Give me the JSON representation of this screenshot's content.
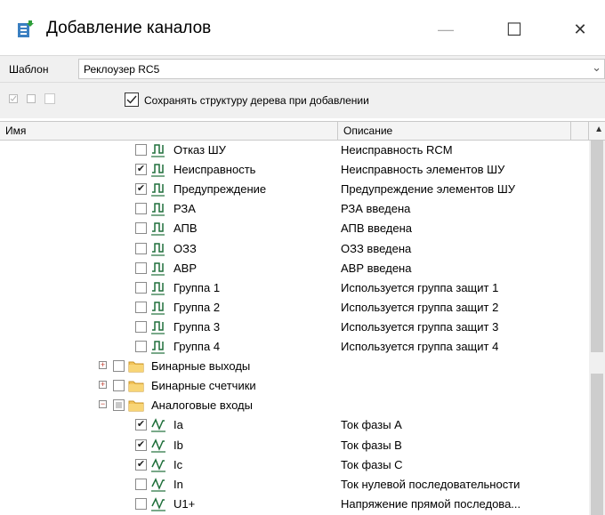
{
  "window": {
    "title": "Добавление каналов",
    "minimize_glyph": "—",
    "maximize_glyph": "☐",
    "close_glyph": "✕"
  },
  "template": {
    "label": "Шаблон",
    "value": "Реклоузер RC5"
  },
  "toolbar": {
    "keep_structure_label": "Сохранять структуру дерева при добавлении",
    "keep_structure_checked": true
  },
  "table": {
    "headers": {
      "name": "Имя",
      "description": "Описание"
    },
    "rows": [
      {
        "name": "Отказ ШУ",
        "description": "Неисправность RCM",
        "checked": false,
        "icon": "binary-signal-icon"
      },
      {
        "name": "Неисправность",
        "description": "Неисправность элементов ШУ",
        "checked": true,
        "icon": "binary-signal-icon"
      },
      {
        "name": "Предупреждение",
        "description": "Предупреждение элементов ШУ",
        "checked": true,
        "icon": "binary-signal-icon"
      },
      {
        "name": "РЗА",
        "description": "РЗА введена",
        "checked": false,
        "icon": "binary-signal-icon"
      },
      {
        "name": "АПВ",
        "description": "АПВ введена",
        "checked": false,
        "icon": "binary-signal-icon"
      },
      {
        "name": "ОЗЗ",
        "description": "ОЗЗ введена",
        "checked": false,
        "icon": "binary-signal-icon"
      },
      {
        "name": "АВР",
        "description": "АВР введена",
        "checked": false,
        "icon": "binary-signal-icon"
      },
      {
        "name": "Группа 1",
        "description": "Используется группа защит 1",
        "checked": false,
        "icon": "binary-signal-icon"
      },
      {
        "name": "Группа 2",
        "description": "Используется группа защит 2",
        "checked": false,
        "icon": "binary-signal-icon"
      },
      {
        "name": "Группа 3",
        "description": "Используется группа защит 3",
        "checked": false,
        "icon": "binary-signal-icon"
      },
      {
        "name": "Группа 4",
        "description": "Используется группа защит 4",
        "checked": false,
        "icon": "binary-signal-icon"
      },
      {
        "name": "Бинарные выходы",
        "description": "",
        "checked": false,
        "icon": "folder-icon",
        "folder": true,
        "expander": "+"
      },
      {
        "name": "Бинарные счетчики",
        "description": "",
        "checked": false,
        "icon": "folder-icon",
        "folder": true,
        "expander": "+"
      },
      {
        "name": "Аналоговые входы",
        "description": "",
        "checked": "partial",
        "icon": "folder-icon",
        "folder": true,
        "expander": "−"
      },
      {
        "name": "Ia",
        "description": "Ток фазы A",
        "checked": true,
        "icon": "analog-signal-icon"
      },
      {
        "name": "Ib",
        "description": "Ток фазы B",
        "checked": true,
        "icon": "analog-signal-icon"
      },
      {
        "name": "Ic",
        "description": "Ток фазы C",
        "checked": true,
        "icon": "analog-signal-icon"
      },
      {
        "name": "In",
        "description": "Ток нулевой последовательности",
        "checked": false,
        "icon": "analog-signal-icon"
      },
      {
        "name": "U1+",
        "description": "Напряжение прямой последова...",
        "checked": false,
        "icon": "analog-signal-icon"
      }
    ]
  }
}
